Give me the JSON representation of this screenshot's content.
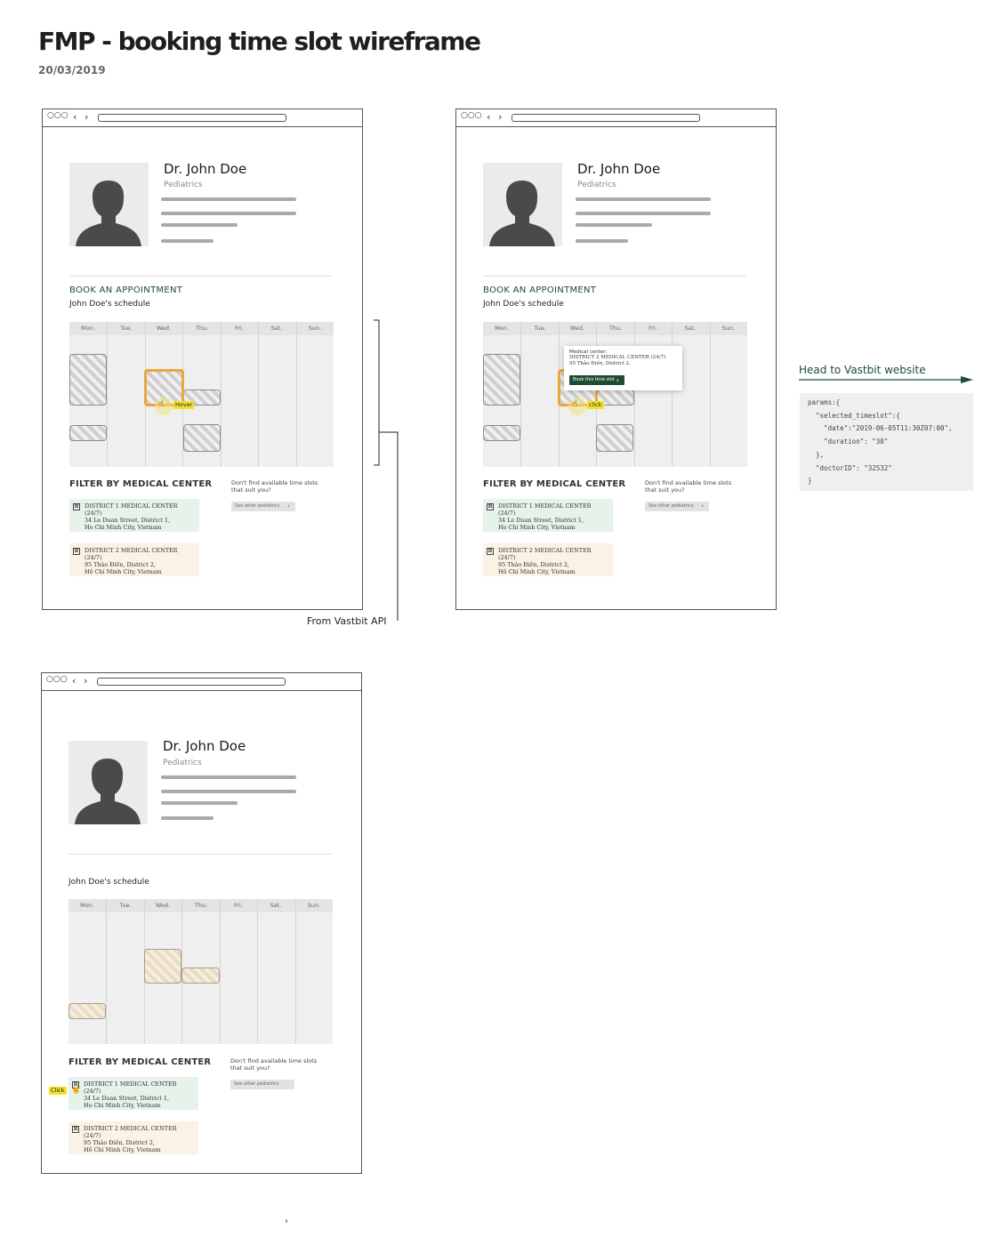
{
  "page": {
    "title": "FMP - booking time slot wireframe",
    "date": "20/03/2019",
    "bottom_glyph": "›"
  },
  "browser": {
    "dots": "○○○",
    "back": "‹",
    "forward": "›"
  },
  "doctor": {
    "name": "Dr. John Doe",
    "specialty": "Pediatrics"
  },
  "booking": {
    "heading": "BOOK AN APPOINTMENT",
    "schedule_label": "John Doe's schedule"
  },
  "calendar": {
    "days": [
      "Mon.",
      "Tue.",
      "Wed.",
      "Thu.",
      "Fri.",
      "Sat.",
      "Sun."
    ]
  },
  "filter": {
    "heading": "FILTER BY MEDICAL CENTER",
    "centers": [
      {
        "name": "DISTRICT 1 MEDICAL CENTER (24/7)",
        "address1": "34 Le Duan Street, District 1,",
        "address2": "Ho Chi Minh City, Vietnam"
      },
      {
        "name": "DISTRICT 2 MEDICAL CENTER (24/7)",
        "address1": "95 Thảo Điền, District 2,",
        "address2": "Hồ Chí Minh City, Vietnam"
      }
    ],
    "checkbox_mark": "⊠",
    "dont_find": "Don't find available time slots that suit you?",
    "see_other": "See other pediatrics"
  },
  "popup": {
    "label": "Medical center:",
    "center": "DISTRICT 2 MEDICAL CENTER (24/7)",
    "address": "95 Thảo Điền, District 2,",
    "button": "Book this time slot"
  },
  "annotations": {
    "hover": "Hover",
    "click_lower": "click",
    "click_upper": "Click",
    "from_api": "From Vastbit API",
    "head_to": "Head to Vastbit website"
  },
  "code": {
    "lines": [
      "params:{",
      "  \"selected_timeslot\":{",
      "    \"date\":\"2019-06-05T11:30Z07:00\",",
      "    \"duration\": \"30\"",
      "  },",
      "  \"doctorID\": \"32532\"",
      "}"
    ]
  },
  "colors": {
    "accent_green": "#1e4d35",
    "highlight_yellow": "#f4e12b",
    "selected_orange": "#e8a83a",
    "green_card": "#e6f2ea",
    "orange_card": "#fbf2e6"
  }
}
